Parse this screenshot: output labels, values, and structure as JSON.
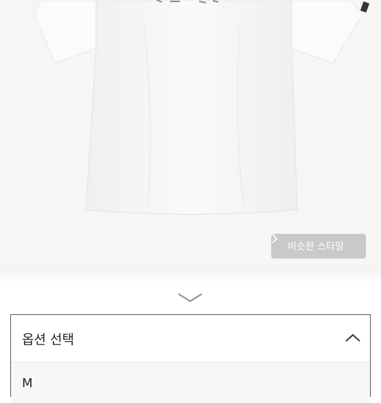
{
  "similar_style": {
    "label": "비슷한 스타일",
    "icon": "chevron-right-icon"
  },
  "sheet": {
    "handle_icon": "chevron-down-icon"
  },
  "option_select": {
    "title": "옵션 선택",
    "toggle_icon": "chevron-up-icon",
    "items": [
      "M"
    ]
  },
  "colors": {
    "button_bg": "#c9c9c9",
    "product_bg": "#f6f6f4",
    "border": "#555555"
  }
}
